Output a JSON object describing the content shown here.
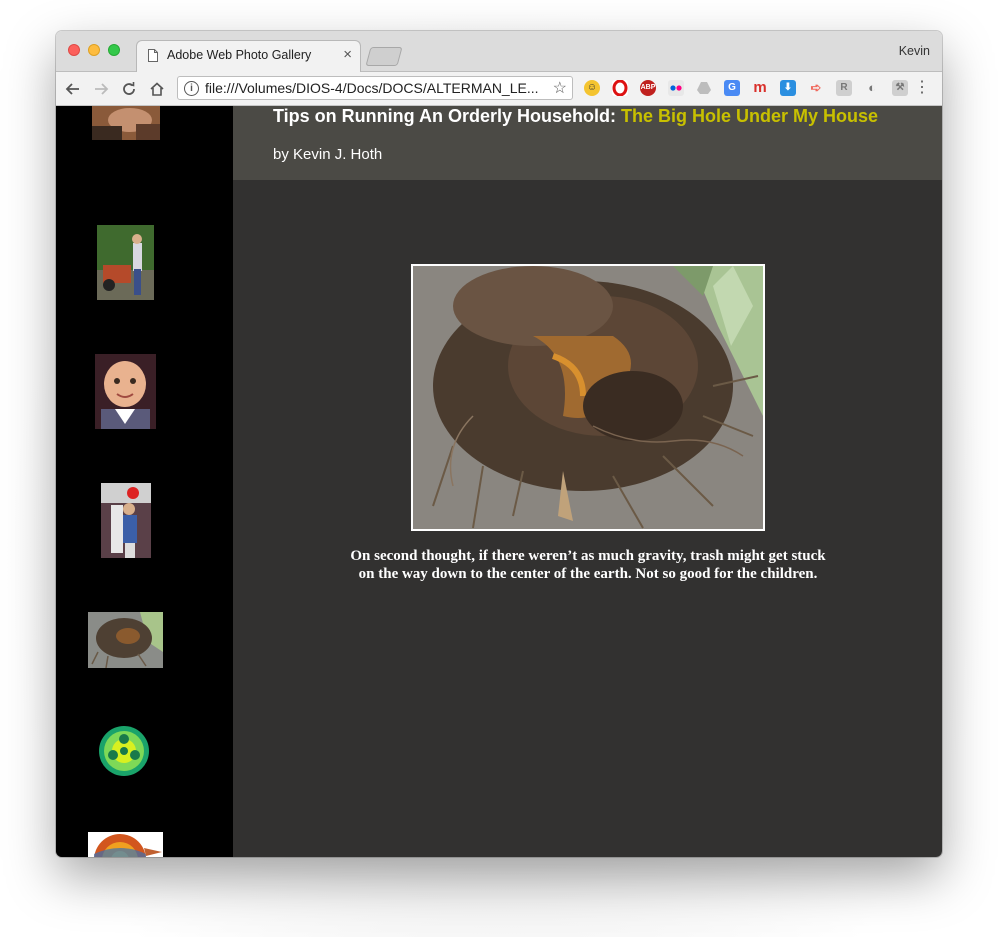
{
  "window": {
    "tab_title": "Adobe Web Photo Gallery",
    "tab_close": "×",
    "profile_name": "Kevin"
  },
  "toolbar": {
    "url": "file:///Volumes/DIOS-4/Docs/DOCS/ALTERMAN_LE...",
    "extensions": [
      "emoji-icon",
      "opera-icon",
      "adblock-plus-icon",
      "flickr-icon",
      "drive-icon",
      "translate-icon",
      "m-icon",
      "download-icon",
      "arrow-icon",
      "r-icon",
      "camera-icon",
      "tools-icon"
    ]
  },
  "page": {
    "title_main": "Tips on Running An Orderly Household: ",
    "title_sub": "The Big Hole Under My House",
    "byline": "by Kevin J. Hoth",
    "caption": "On second thought, if there weren’t as much gravity, trash might get stuck on the way down to the center of the earth. Not so good for the children.",
    "colors": {
      "sidebar_bg": "#000000",
      "header_bg": "#4b4a45",
      "content_bg": "#323130",
      "title_accent": "#c8c000"
    }
  },
  "thumbnails": [
    "thumbnail-person-tool",
    "thumbnail-man-tiller",
    "thumbnail-baby-face",
    "thumbnail-child-costume",
    "thumbnail-root-clump",
    "thumbnail-green-molecule",
    "thumbnail-earth-diagram"
  ]
}
